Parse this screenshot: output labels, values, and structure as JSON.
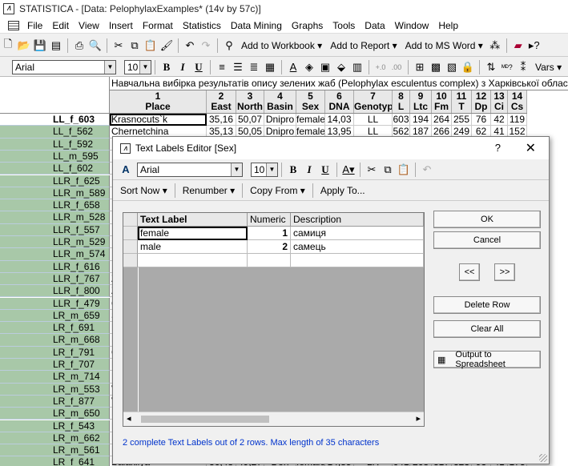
{
  "app": {
    "title": "STATISTICA - [Data: PelophylaxExamples* (14v by 57c)]"
  },
  "menu": [
    "File",
    "Edit",
    "View",
    "Insert",
    "Format",
    "Statistics",
    "Data Mining",
    "Graphs",
    "Tools",
    "Data",
    "Window",
    "Help"
  ],
  "toolbar": {
    "add_workbook": "Add to Workbook",
    "add_report": "Add to Report",
    "add_msword": "Add to MS Word",
    "vars": "Vars"
  },
  "format_bar": {
    "font": "Arial",
    "size": "10",
    "bold": "B",
    "italic": "I",
    "underline": "U"
  },
  "sheet": {
    "caption": "Навчальна вибірка результатів опису зелених жаб (Pelophylax esculentus complex) з Харківської області",
    "columns": [
      {
        "num": "1",
        "name": "Place"
      },
      {
        "num": "2",
        "name": "East"
      },
      {
        "num": "3",
        "name": "North"
      },
      {
        "num": "4",
        "name": "Basin"
      },
      {
        "num": "5",
        "name": "Sex"
      },
      {
        "num": "6",
        "name": "DNA"
      },
      {
        "num": "7",
        "name": "Genotyp"
      },
      {
        "num": "8",
        "name": "L"
      },
      {
        "num": "9",
        "name": "Ltc"
      },
      {
        "num": "10",
        "name": "Fm"
      },
      {
        "num": "11",
        "name": "T"
      },
      {
        "num": "12",
        "name": "Dp"
      },
      {
        "num": "13",
        "name": "Ci"
      },
      {
        "num": "14",
        "name": "Cs"
      }
    ],
    "row_headers": [
      "LL_f_603",
      "LL_f_562",
      "LL_f_592",
      "LL_m_595",
      "LL_f_602",
      "LLR_f_625",
      "LLR_m_589",
      "LLR_f_658",
      "LLR_m_528",
      "LLR_f_557",
      "LLR_m_529",
      "LLR_m_574",
      "LLR_f_616",
      "LLR_f_767",
      "LLR_f_800",
      "LLR_f_479",
      "LR_m_659",
      "LR_f_691",
      "LR_m_668",
      "LR_f_791",
      "LR_f_707",
      "LR_m_714",
      "LR_m_553",
      "LR_f_877",
      "LR_m_650",
      "LR_f_543",
      "LR_m_662",
      "LR_m_561",
      "LR_f_641"
    ],
    "left_letters": [
      "",
      "",
      "",
      "",
      "",
      "",
      "",
      "",
      "",
      "",
      "",
      "",
      "",
      "Z",
      "Z",
      "C",
      "S",
      "E",
      "L",
      "C",
      "E",
      "N",
      "V",
      "V",
      "K",
      "L",
      "K",
      "K",
      ""
    ],
    "full_rows": [
      {
        "row": 0,
        "cells": [
          "Krasnocuts`k",
          "35,16",
          "50,07",
          "Dnipro",
          "female",
          "14,03",
          "LL",
          "603",
          "194",
          "264",
          "255",
          "76",
          "42",
          "119"
        ]
      },
      {
        "row": 1,
        "cells": [
          "Chernetchina",
          "35,13",
          "50,05",
          "Dnipro",
          "female",
          "13,95",
          "LL",
          "562",
          "187",
          "266",
          "249",
          "62",
          "41",
          "152"
        ]
      },
      {
        "row": 28,
        "cells": [
          "Balakliya",
          "36,48",
          "49,27",
          "Don",
          "female",
          "14,85",
          "LR",
          "641",
          "268",
          "317",
          "323",
          "93",
          "41",
          "173"
        ]
      }
    ]
  },
  "dialog": {
    "title": "Text Labels Editor [Sex]",
    "help": "?",
    "close": "✕",
    "font": "Arial",
    "size": "10",
    "menu": [
      "Sort Now",
      "Renumber",
      "Copy From",
      "Apply To..."
    ],
    "headers": [
      "Text Label",
      "Numeric",
      "Description"
    ],
    "rows": [
      {
        "label": "female",
        "numeric": "1",
        "desc": "самиця"
      },
      {
        "label": "male",
        "numeric": "2",
        "desc": "самець"
      }
    ],
    "buttons": {
      "ok": "OK",
      "cancel": "Cancel",
      "prev": "<<",
      "next": ">>",
      "delete_row": "Delete Row",
      "clear_all": "Clear All",
      "output": "Output to Spreadsheet"
    },
    "status": "2 complete Text Labels out of 2 rows. Max length of 35 characters"
  }
}
